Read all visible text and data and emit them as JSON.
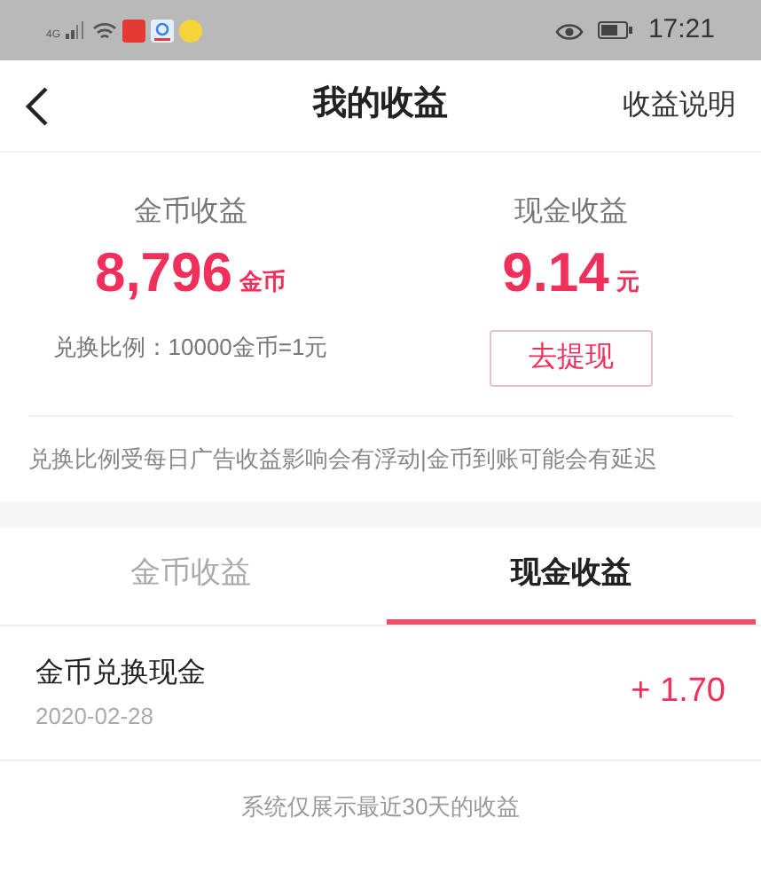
{
  "status_bar": {
    "network": "4G",
    "time": "17:21"
  },
  "header": {
    "title": "我的收益",
    "action": "收益说明"
  },
  "summary": [
    {
      "label": "金币收益",
      "amount": "8,796",
      "unit": "金币",
      "kind": "ratio",
      "note": "兑换比例：10000金币=1元"
    },
    {
      "label": "现金收益",
      "amount": "9.14",
      "unit": "元",
      "kind": "button",
      "note": "去提现"
    }
  ],
  "notice": "兑换比例受每日广告收益影响会有浮动|金币到账可能会有延迟",
  "tabs": [
    {
      "label": "金币收益",
      "selected": false
    },
    {
      "label": "现金收益",
      "selected": true
    }
  ],
  "records": [
    {
      "title": "金币兑换现金",
      "date": "2020-02-28",
      "amount": "+ 1.70"
    }
  ],
  "footer": "系统仅展示最近30天的收益"
}
